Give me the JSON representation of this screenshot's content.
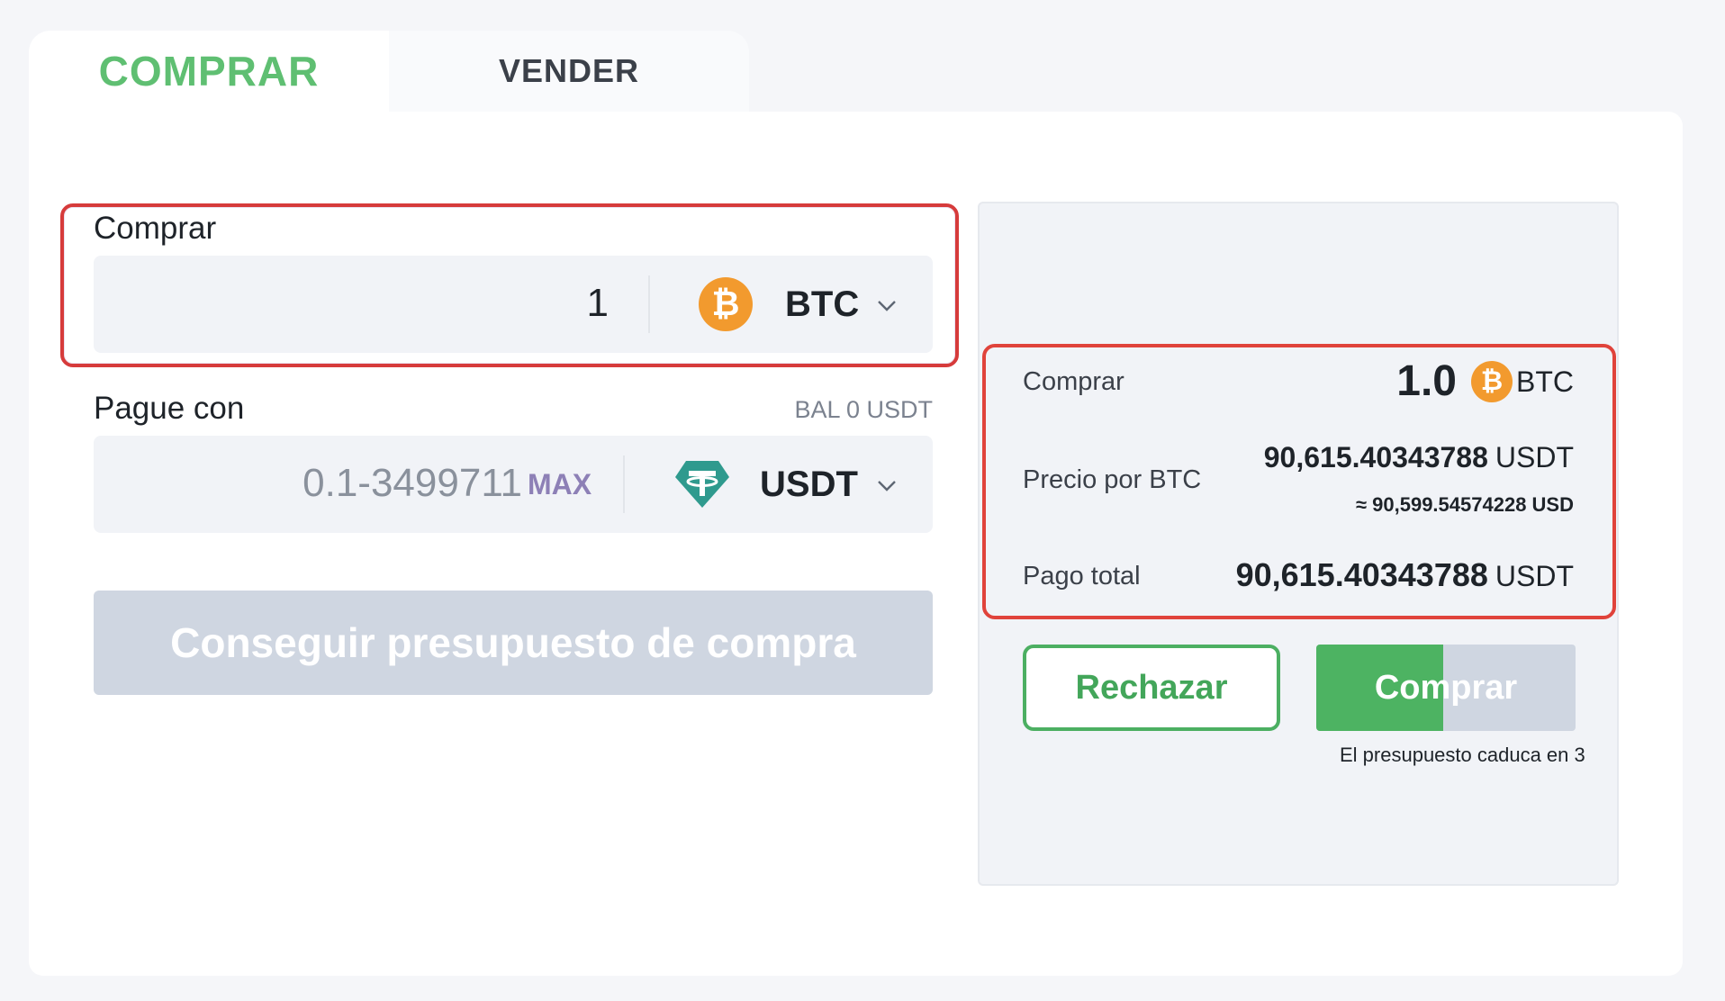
{
  "tabs": {
    "buy_label": "COMPRAR",
    "sell_label": "VENDER"
  },
  "form": {
    "buy_section_label": "Comprar",
    "buy_amount": "1",
    "buy_coin": "BTC",
    "buy_coin_icon": "bitcoin-icon",
    "pay_section_label": "Pague con",
    "balance": "BAL 0 USDT",
    "pay_placeholder": "0.1-3499711",
    "max_label": "MAX",
    "pay_coin": "USDT",
    "pay_coin_icon": "tether-icon",
    "quote_button_label": "Conseguir presupuesto de compra"
  },
  "quote": {
    "buy_label": "Comprar",
    "buy_amount": "1.0",
    "buy_coin": "BTC",
    "price_label": "Precio por BTC",
    "price_value": "90,615.40343788",
    "price_unit": "USDT",
    "price_usd": "≈ 90,599.54574228 USD",
    "total_label": "Pago total",
    "total_value": "90,615.40343788",
    "total_unit": "USDT",
    "reject_label": "Rechazar",
    "confirm_label": "Comprar",
    "confirm_progress": 0.49,
    "expire_note": "El presupuesto caduca en 3"
  },
  "colors": {
    "accent_green": "#4db362",
    "highlight_red": "#e0433b",
    "bitcoin_orange": "#f29a2e",
    "tether_teal": "#2f9a8e"
  }
}
